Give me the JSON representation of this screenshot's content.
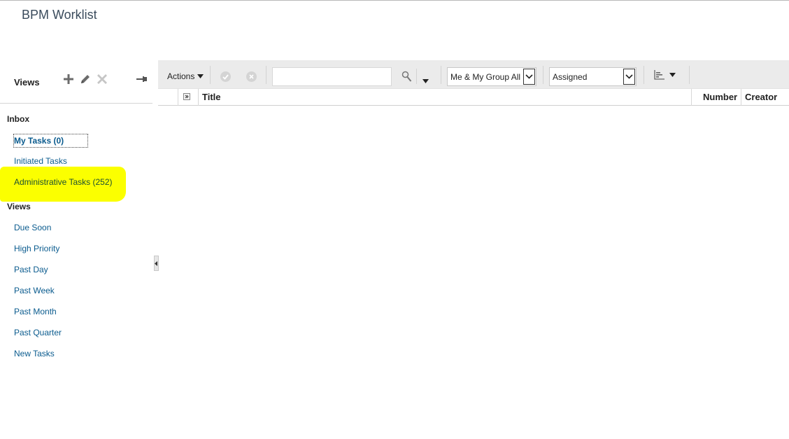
{
  "app": {
    "title": "BPM Worklist"
  },
  "views_panel": {
    "title": "Views",
    "icons": [
      "add-icon",
      "edit-icon",
      "delete-icon",
      "pin-icon"
    ]
  },
  "inbox": {
    "label": "Inbox",
    "items": [
      {
        "label": "My Tasks (0)",
        "selected": true
      },
      {
        "label": "Initiated Tasks"
      },
      {
        "label": "Administrative Tasks (252)",
        "highlighted": true
      }
    ]
  },
  "views": {
    "label": "Views",
    "items": [
      {
        "label": "Due Soon"
      },
      {
        "label": "High Priority"
      },
      {
        "label": "Past Day"
      },
      {
        "label": "Past Week"
      },
      {
        "label": "Past Month"
      },
      {
        "label": "Past Quarter"
      },
      {
        "label": "New Tasks"
      }
    ]
  },
  "toolbar": {
    "actions_label": "Actions",
    "search_value": "",
    "assignee_filter": "Me & My Group All",
    "state_filter": "Assigned"
  },
  "table": {
    "columns": [
      "Title",
      "Number",
      "Creator"
    ]
  },
  "colors": {
    "link": "#0a5b8e",
    "highlight": "#fbff00",
    "toolbar_bg": "#ebebeb"
  }
}
